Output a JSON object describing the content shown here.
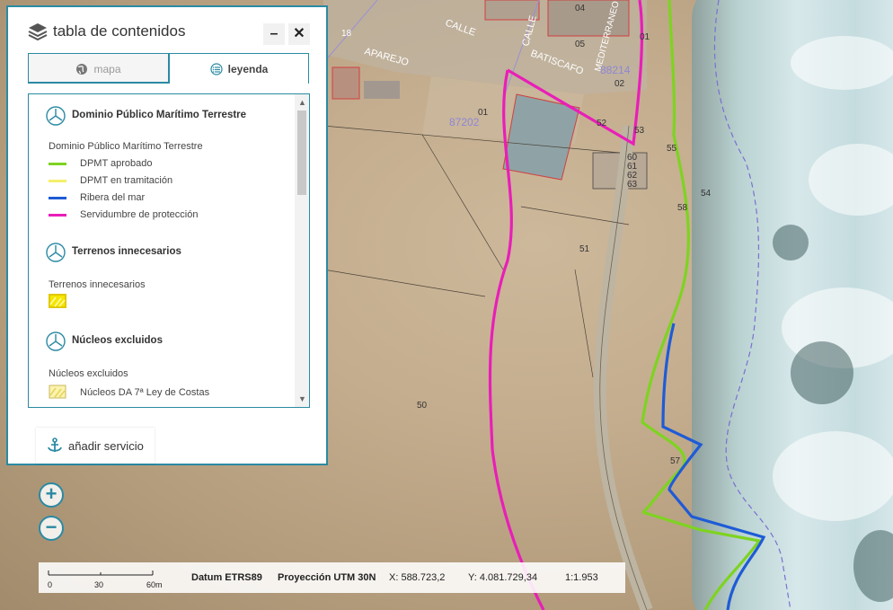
{
  "map": {
    "labels": {
      "parcel_main": "87202",
      "parcel_top": "88214",
      "street_calle": "CALLE",
      "street_aparejo": "APAREJO",
      "street_batiscafo": "BATISCAFO",
      "street_calle2": "CALLE",
      "street_mediterraneo": "MEDITERRANEO",
      "n01a": "01",
      "n01b": "01",
      "n02": "02",
      "n04": "04",
      "n05": "05",
      "n18": "18",
      "n52": "52",
      "n53": "53",
      "n55": "55",
      "n60": "60",
      "n61": "61",
      "n62": "62",
      "n63": "63",
      "n54": "54",
      "n58": "58",
      "n51": "51",
      "n50": "50",
      "n57": "57"
    },
    "colors": {
      "dpmt_aprobado": "#7ed321",
      "dpmt_tramitacion": "#f5f06a",
      "ribera": "#1f5bd6",
      "servidumbre": "#e91eb8",
      "cadastral": "#9b8fd6"
    }
  },
  "toc": {
    "title": "tabla de contenidos",
    "minimize": "–",
    "close": "✕",
    "tabs": [
      {
        "label": "mapa",
        "icon": "globe-icon",
        "active": false
      },
      {
        "label": "leyenda",
        "icon": "list-icon",
        "active": true
      }
    ],
    "legend": {
      "sections": [
        {
          "title": "Dominio Público Marítimo Terrestre",
          "subtitle": "Dominio Público Marítimo Terrestre",
          "items": [
            {
              "label": "DPMT aprobado",
              "color": "#7ed321"
            },
            {
              "label": "DPMT en tramitación",
              "color": "#f5f06a"
            },
            {
              "label": "Ribera del mar",
              "color": "#1f5bd6"
            },
            {
              "label": "Servidumbre de protección",
              "color": "#e91eb8"
            }
          ]
        },
        {
          "title": "Terrenos innecesarios",
          "subtitle": "Terrenos innecesarios"
        },
        {
          "title": "Núcleos excluidos",
          "subtitle": "Núcleos excluidos",
          "items": [
            {
              "label": "Núcleos DA 7ª Ley de Costas"
            }
          ]
        }
      ]
    },
    "add_service": "añadir servicio"
  },
  "zoom": {
    "in": "+",
    "out": "−"
  },
  "status": {
    "scale_ticks": [
      "0",
      "30",
      "60m"
    ],
    "datum": "Datum ETRS89",
    "projection": "Proyección UTM 30N",
    "x": "X: 588.723,2",
    "y": "Y: 4.081.729,34",
    "scale": "1:1.953"
  }
}
